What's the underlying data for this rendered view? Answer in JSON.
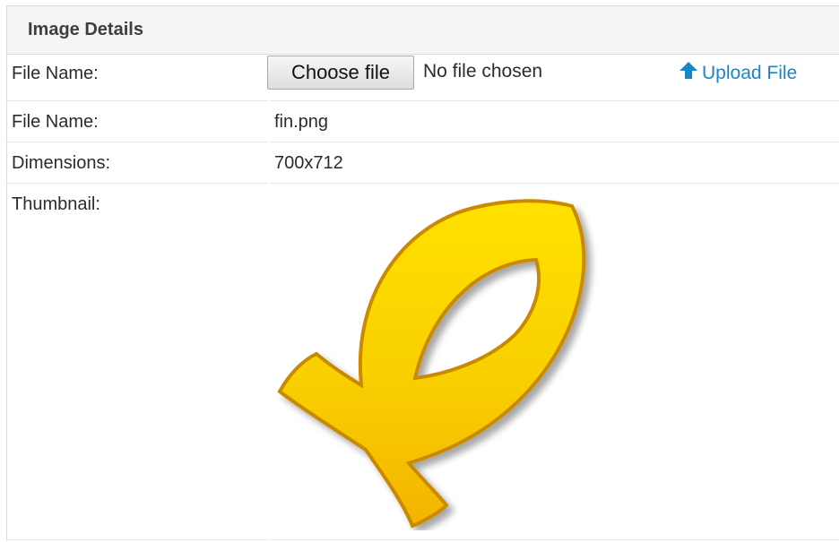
{
  "panel": {
    "title": "Image Details"
  },
  "upload_row": {
    "label": "File Name:",
    "choose_button": "Choose file",
    "file_status": "No file chosen",
    "upload_link": "Upload File"
  },
  "details": {
    "file_name_label": "File Name:",
    "file_name_value": "fin.png",
    "dimensions_label": "Dimensions:",
    "dimensions_value": "700x712",
    "thumbnail_label": "Thumbnail:"
  },
  "colors": {
    "accent_link": "#1a86c8",
    "header_bg": "#f5f5f5",
    "fish_fill": "#f7c600",
    "fish_outline": "#c98a00"
  },
  "icons": {
    "upload": "arrow-up-icon",
    "thumbnail": "fish-symbol-image"
  }
}
